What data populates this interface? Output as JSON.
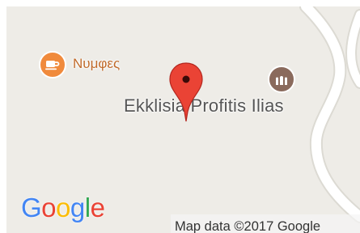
{
  "map": {
    "background_color": "#eeece7",
    "road_color": "#ffffff",
    "road_edge_color": "#dcdad3"
  },
  "pois": {
    "cafe": {
      "label": "Νυμφες",
      "icon": "coffee-cup-icon",
      "color": "#f08a3c"
    },
    "church": {
      "label": "Ekklisia Profitis Ilias",
      "icon": "church-icon",
      "color": "#8a6a5c"
    }
  },
  "marker": {
    "icon": "map-pin-icon",
    "color": "#ea4335"
  },
  "logo": {
    "letters": [
      "G",
      "o",
      "o",
      "g",
      "l",
      "e"
    ],
    "colors": [
      "#4285f4",
      "#ea4335",
      "#fbbc05",
      "#4285f4",
      "#34a853",
      "#ea4335"
    ]
  },
  "attribution": {
    "text": "Map data ©2017 Google"
  }
}
